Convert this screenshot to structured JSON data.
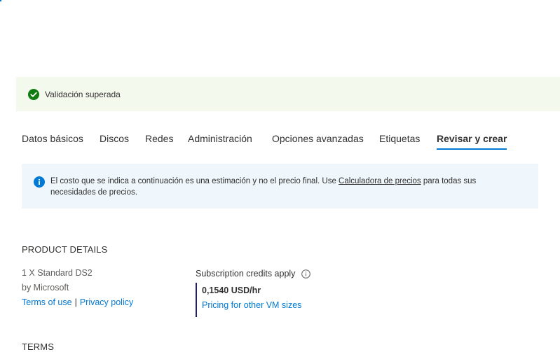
{
  "validation": {
    "text": "Validación superada"
  },
  "tabs": [
    {
      "label": "Datos básicos"
    },
    {
      "label": "Discos"
    },
    {
      "label": "Redes"
    },
    {
      "label": "Administración"
    },
    {
      "label": "Opciones avanzadas"
    },
    {
      "label": "Etiquetas"
    },
    {
      "label": "Revisar y crear"
    }
  ],
  "active_tab": "Revisar y crear",
  "info": {
    "text_before": "El costo que se indica a continuación es una estimación y no el precio final. Use ",
    "link": "Calculadora de precios",
    "text_after": " para todas sus necesidades de precios."
  },
  "product_details": {
    "title": "PRODUCT DETAILS",
    "product": "1 X Standard DS2",
    "publisher": "by Microsoft",
    "terms_link": "Terms of use",
    "separator": "|",
    "privacy_link": "Privacy policy",
    "credits_label": "Subscription credits apply",
    "price": "0,1540 USD/hr",
    "other_sizes_link": "Pricing for other VM sizes"
  },
  "terms": {
    "title": "TERMS"
  },
  "colors": {
    "accent": "#0078d4",
    "success": "#107c10",
    "info_bg": "#eff6fc",
    "success_bg": "#f4f9ed"
  },
  "icons": {
    "validation": "checkmark-circle-icon",
    "info": "info-icon",
    "credits_info": "info-outline-icon"
  }
}
